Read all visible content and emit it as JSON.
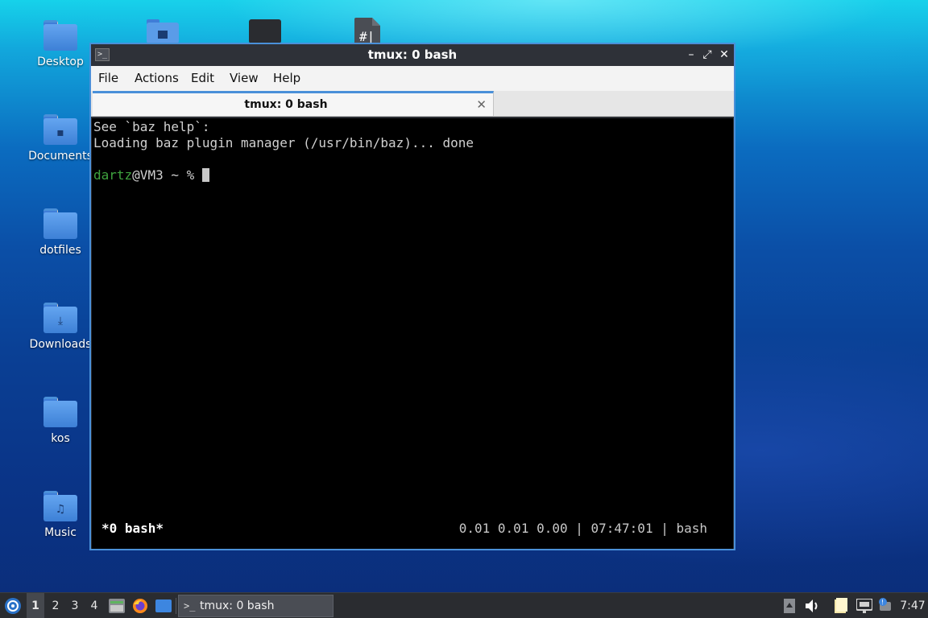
{
  "desktop": {
    "icons": [
      {
        "label": "Desktop",
        "emblem": ""
      },
      {
        "label": "Documents",
        "emblem": "▪"
      },
      {
        "label": "dotfiles",
        "emblem": ""
      },
      {
        "label": "Downloads",
        "emblem": "⤓"
      },
      {
        "label": "kos",
        "emblem": ""
      },
      {
        "label": "Music",
        "emblem": "♫"
      }
    ],
    "top_icons": [
      "pictures-folder-icon",
      "dark-file-icon",
      "spreadsheet-file-icon"
    ]
  },
  "window": {
    "title": "tmux: 0 bash",
    "controls": {
      "minimize": "–",
      "maximize": "⤢",
      "close": "✕"
    },
    "menu": [
      "File",
      "Actions",
      "Edit",
      "View",
      "Help"
    ],
    "tab": {
      "title": "tmux: 0 bash",
      "close": "✕"
    }
  },
  "terminal": {
    "lines": [
      "See `baz help`:",
      "Loading baz plugin manager (/usr/bin/baz)... done"
    ],
    "prompt": {
      "user": "dartz",
      "rest": "@VM3 ~ % "
    },
    "status": {
      "left": "*0 bash*",
      "right": "0.01 0.01 0.00 | 07:47:01 | bash"
    }
  },
  "taskbar": {
    "workspaces": [
      "1",
      "2",
      "3",
      "4"
    ],
    "active_workspace": "1",
    "launchers": [
      "file-manager-icon",
      "firefox-icon",
      "desktop-icon"
    ],
    "task": {
      "title": "tmux: 0 bash"
    },
    "tray": [
      "clipboard-icon",
      "volume-icon",
      "notes-icon",
      "network-icon",
      "updates-icon"
    ],
    "clock": "7:47"
  },
  "colors": {
    "accent": "#4a90d9",
    "prompt_user": "#3fa33f",
    "terminal_bg": "#000000"
  }
}
